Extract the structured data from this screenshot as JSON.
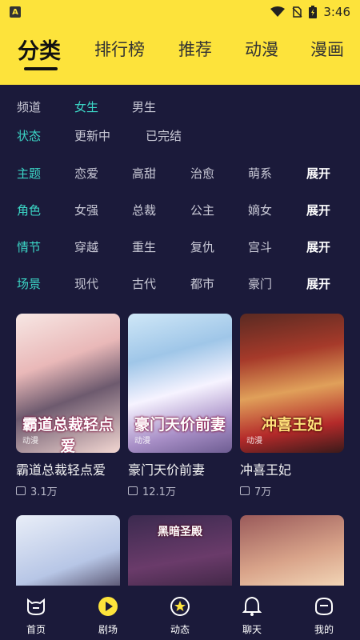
{
  "status": {
    "time": "3:46"
  },
  "tabs": [
    {
      "label": "分类",
      "active": true
    },
    {
      "label": "排行榜",
      "active": false
    },
    {
      "label": "推荐",
      "active": false
    },
    {
      "label": "动漫",
      "active": false
    },
    {
      "label": "漫画",
      "active": false
    }
  ],
  "filters": {
    "channel": {
      "label": "频道",
      "options": [
        "女生",
        "男生"
      ],
      "selected": "女生"
    },
    "state": {
      "label": "状态",
      "options": [
        "更新中",
        "已完结"
      ]
    },
    "theme": {
      "label": "主题",
      "options": [
        "恋爱",
        "高甜",
        "治愈",
        "萌系"
      ],
      "expand": "展开"
    },
    "role": {
      "label": "角色",
      "options": [
        "女强",
        "总裁",
        "公主",
        "嫡女"
      ],
      "expand": "展开"
    },
    "plot": {
      "label": "情节",
      "options": [
        "穿越",
        "重生",
        "复仇",
        "宫斗"
      ],
      "expand": "展开"
    },
    "scene": {
      "label": "场景",
      "options": [
        "现代",
        "古代",
        "都市",
        "豪门"
      ],
      "expand": "展开"
    }
  },
  "cards": [
    {
      "title": "霸道总裁轻点爱",
      "count": "3.1万",
      "cover_text": "霸道总裁轻点爱",
      "tag": "动漫"
    },
    {
      "title": "豪门天价前妻",
      "count": "12.1万",
      "cover_text": "豪门天价前妻",
      "tag": "动漫"
    },
    {
      "title": "冲喜王妃",
      "count": "7万",
      "cover_text": "冲喜王妃",
      "tag": "动漫"
    },
    {
      "title": "",
      "count": "",
      "cover_text": "",
      "tag": ""
    },
    {
      "title": "",
      "count": "",
      "cover_text": "黑暗圣殿",
      "tag": ""
    },
    {
      "title": "",
      "count": "",
      "cover_text": "",
      "tag": ""
    }
  ],
  "colors": {
    "header": "#fde33b",
    "background": "#1b1a3a",
    "accent": "#3bd6c6"
  },
  "nav": [
    {
      "label": "首页",
      "icon": "home-cat-icon"
    },
    {
      "label": "剧场",
      "icon": "play-icon",
      "active": true
    },
    {
      "label": "动态",
      "icon": "star-icon"
    },
    {
      "label": "聊天",
      "icon": "bell-icon"
    },
    {
      "label": "我的",
      "icon": "profile-icon"
    }
  ]
}
